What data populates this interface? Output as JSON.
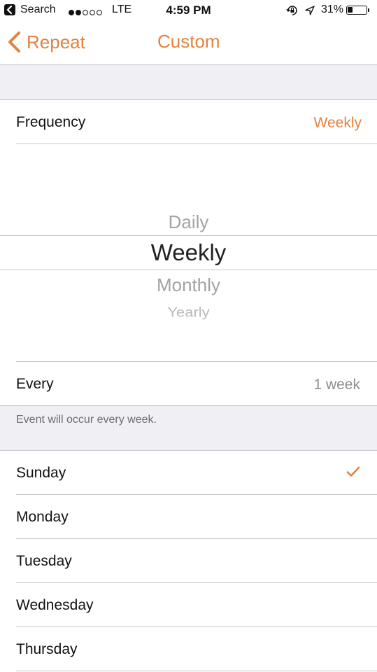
{
  "status_bar": {
    "back_app": "Search",
    "carrier": "LTE",
    "time": "4:59 PM",
    "battery": "31%",
    "battery_level": 0.31
  },
  "nav": {
    "back_label": "Repeat",
    "title": "Custom"
  },
  "frequency": {
    "label": "Frequency",
    "value": "Weekly"
  },
  "picker": {
    "options": [
      "Daily",
      "Weekly",
      "Monthly",
      "Yearly"
    ],
    "selected": "Weekly"
  },
  "every": {
    "label": "Every",
    "value": "1 week"
  },
  "footnote": "Event will occur every week.",
  "days": [
    {
      "label": "Sunday",
      "checked": true
    },
    {
      "label": "Monday",
      "checked": false
    },
    {
      "label": "Tuesday",
      "checked": false
    },
    {
      "label": "Wednesday",
      "checked": false
    },
    {
      "label": "Thursday",
      "checked": false
    }
  ],
  "colors": {
    "accent": "#e4823f",
    "group_background": "#efeff4",
    "separator": "#c8c7cc",
    "secondary_text": "#8e8e93"
  }
}
